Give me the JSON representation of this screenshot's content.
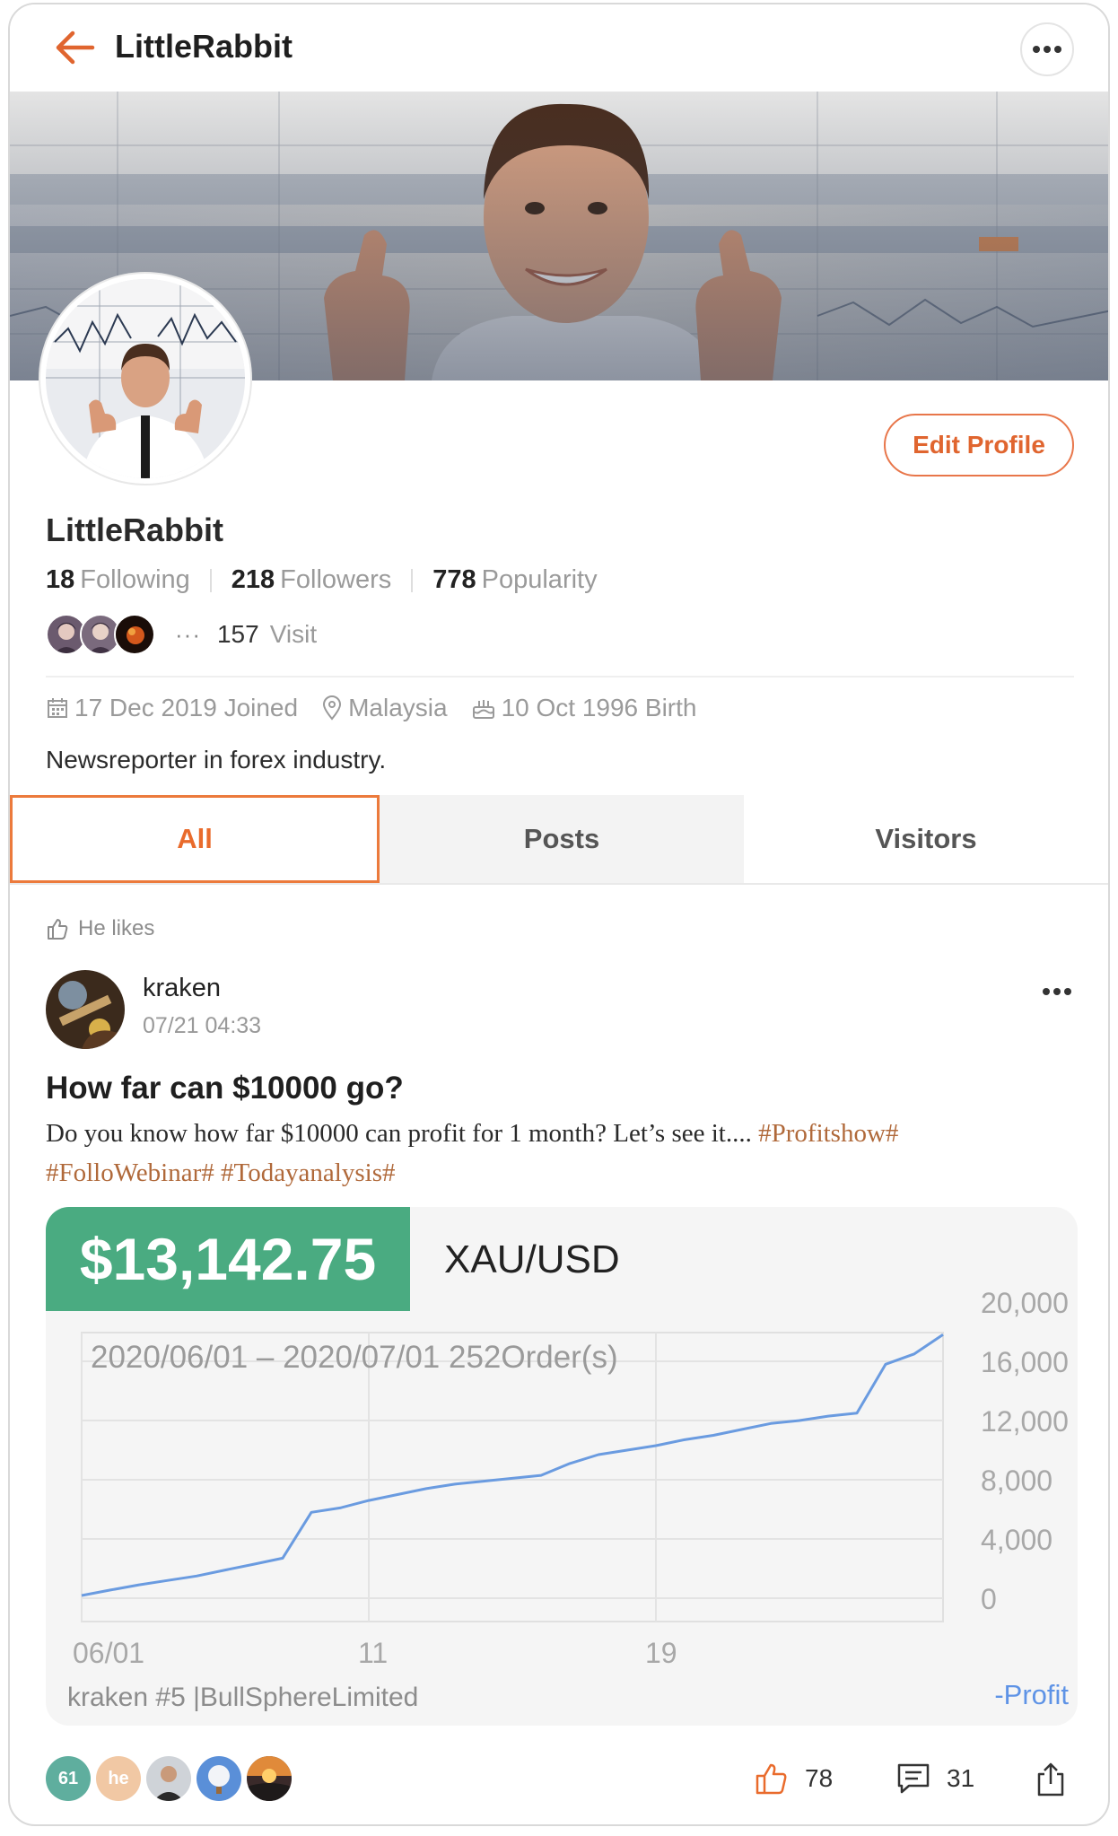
{
  "header": {
    "title": "LittleRabbit",
    "back_icon": "arrow-left-icon",
    "more_icon": "more-horizontal-icon"
  },
  "profile": {
    "name": "LittleRabbit",
    "edit_label": "Edit Profile",
    "stats": [
      {
        "num": "18",
        "label": "Following"
      },
      {
        "num": "218",
        "label": "Followers"
      },
      {
        "num": "778",
        "label": "Popularity"
      }
    ],
    "visits": {
      "dots": "···",
      "count": "157",
      "label": "Visit"
    },
    "joined": "17 Dec 2019 Joined",
    "location": "Malaysia",
    "birth": "10 Oct 1996 Birth",
    "bio": "Newsreporter in forex industry."
  },
  "tabs": [
    {
      "label": "All",
      "active": true
    },
    {
      "label": "Posts",
      "active": false
    },
    {
      "label": "Visitors",
      "active": false
    }
  ],
  "feed": {
    "activity_label": "He likes",
    "post": {
      "user": "kraken",
      "time": "07/21 04:33",
      "title": "How far can $10000 go?",
      "body": "Do you know how far $10000 can profit for 1 month? Let’s see it.... ",
      "tags": [
        "#Profitshow#",
        "#FolloWebinar#",
        "#Todayanalysis#"
      ],
      "card": {
        "pnl": "$13,142.75",
        "pair": "XAU/USD",
        "range": "2020/06/01 – 2020/07/01 252Order(s)",
        "footer": "kraken #5 |BullSphereLimited",
        "legend": "-Profit"
      },
      "reactors": [
        "61",
        "he"
      ],
      "likes": "78",
      "comments": "31"
    }
  },
  "colors": {
    "accent": "#e96b2c",
    "pnl_green": "#4aab81",
    "line_blue": "#6a9be0",
    "tag": "#b0693a"
  },
  "chart_data": {
    "type": "line",
    "x_tick_labels": [
      "06/01",
      "11",
      "19"
    ],
    "y_tick_labels": [
      "20,000",
      "16,000",
      "12,000",
      "8,000",
      "4,000",
      "0"
    ],
    "ylim": [
      0,
      20000
    ],
    "series": [
      {
        "name": "Profit",
        "x": [
          0,
          1,
          2,
          3,
          4,
          5,
          6,
          7,
          8,
          9,
          10,
          11,
          12,
          13,
          14,
          15,
          16,
          17,
          18,
          19,
          20,
          21,
          22,
          23,
          24,
          25,
          26,
          27,
          28,
          29,
          30
        ],
        "values": [
          180,
          550,
          900,
          1200,
          1500,
          1900,
          2300,
          2700,
          5800,
          6100,
          6600,
          7000,
          7400,
          7700,
          7900,
          8100,
          8300,
          9100,
          9700,
          10000,
          10300,
          10700,
          11000,
          11400,
          11800,
          12000,
          12300,
          12500,
          15800,
          16500,
          17800
        ]
      }
    ]
  }
}
